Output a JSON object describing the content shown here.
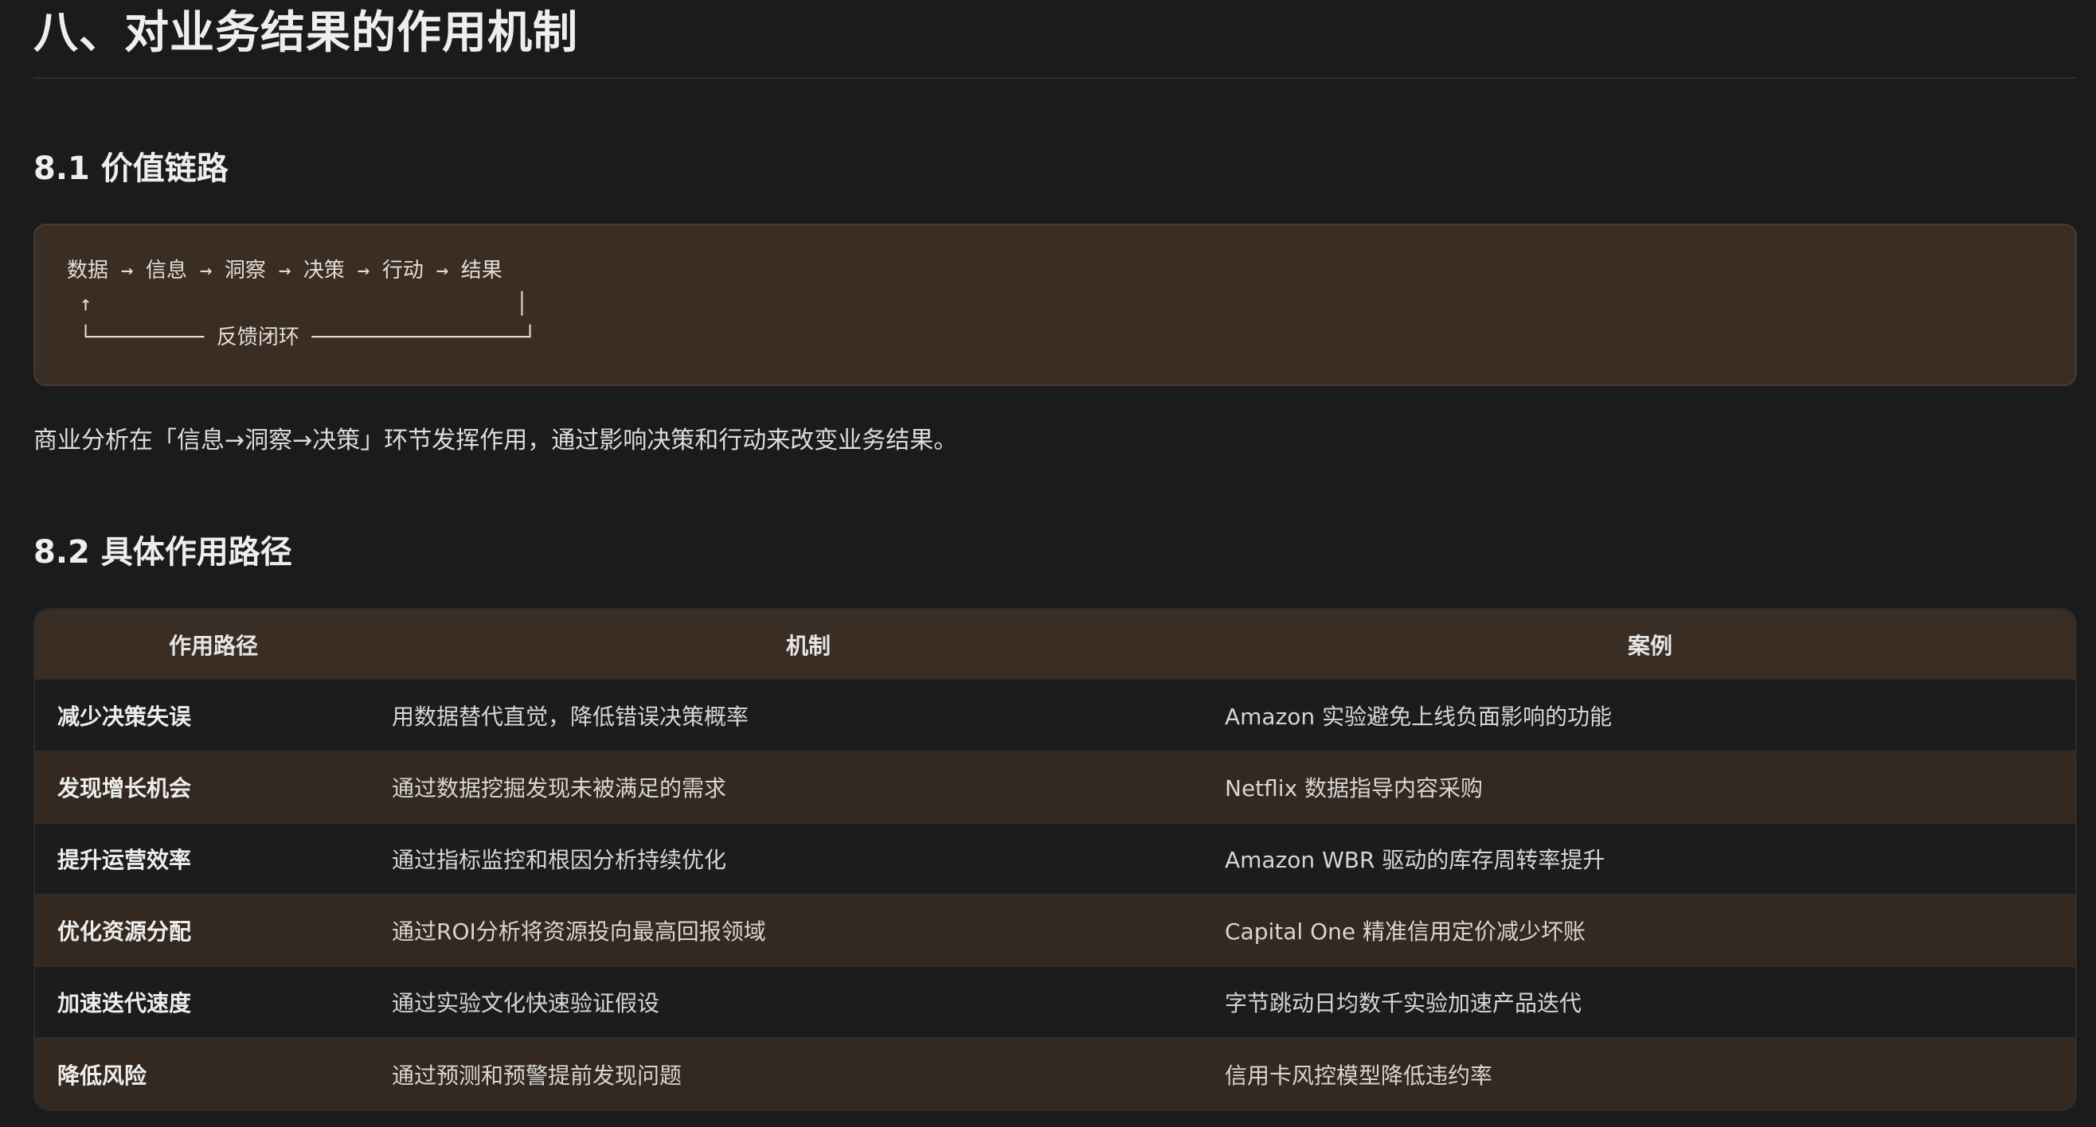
{
  "section8": {
    "title": "八、对业务结果的作用机制"
  },
  "s81": {
    "title": "8.1 价值链路",
    "code_lines": [
      "数据 → 信息 → 洞察 → 决策 → 行动 → 结果",
      " ↑                                  │",
      " └───────── 反馈闭环 ─────────────────┘"
    ],
    "paragraph": "商业分析在「信息→洞察→决策」环节发挥作用，通过影响决策和行动来改变业务结果。"
  },
  "s82": {
    "title": "8.2 具体作用路径",
    "table": {
      "headers": [
        "作用路径",
        "机制",
        "案例"
      ],
      "rows": [
        [
          "减少决策失误",
          "用数据替代直觉，降低错误决策概率",
          "Amazon 实验避免上线负面影响的功能"
        ],
        [
          "发现增长机会",
          "通过数据挖掘发现未被满足的需求",
          "Netflix 数据指导内容采购"
        ],
        [
          "提升运营效率",
          "通过指标监控和根因分析持续优化",
          "Amazon WBR 驱动的库存周转率提升"
        ],
        [
          "优化资源分配",
          "通过ROI分析将资源投向最高回报领域",
          "Capital One 精准信用定价减少坏账"
        ],
        [
          "加速迭代速度",
          "通过实验文化快速验证假设",
          "字节跳动日均数千实验加速产品迭代"
        ],
        [
          "降低风险",
          "通过预测和预警提前发现问题",
          "信用卡风控模型降低违约率"
        ]
      ]
    }
  }
}
